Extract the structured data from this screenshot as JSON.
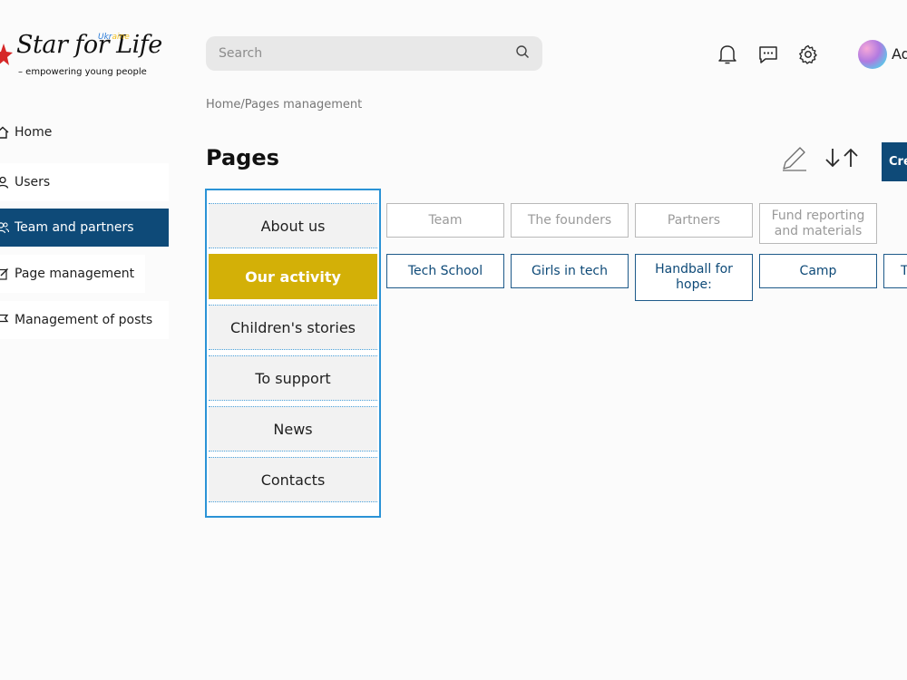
{
  "logo": {
    "name": "Star for Life",
    "ukraine_part1": "Ukr",
    "ukraine_part2": "aine",
    "tagline": "– empowering young people"
  },
  "sidebar": {
    "items": [
      {
        "label": "Home",
        "icon": "home-icon"
      },
      {
        "label": "Users",
        "icon": "user-icon"
      },
      {
        "label": "Team and partners",
        "icon": "users-icon"
      },
      {
        "label": "Page management",
        "icon": "edit-icon"
      },
      {
        "label": "Management of posts",
        "icon": "flag-icon"
      }
    ],
    "active_index": 2
  },
  "search": {
    "placeholder": "Search"
  },
  "header": {
    "icons": [
      "bell-icon",
      "chat-icon",
      "gear-icon"
    ],
    "user_name": "Ad"
  },
  "breadcrumb": "Home/Pages management",
  "page_title": "Pages",
  "toolbar": {
    "create_label": "Cre"
  },
  "pages": [
    {
      "label": "About us"
    },
    {
      "label": "Our activity"
    },
    {
      "label": "Children's stories"
    },
    {
      "label": "To support"
    },
    {
      "label": "News"
    },
    {
      "label": "Contacts"
    }
  ],
  "active_page_index": 1,
  "about_subpages": [
    "Team",
    "The founders",
    "Partners",
    "Fund reporting and materials"
  ],
  "activity_subpages": [
    "Tech School",
    "Girls in tech",
    "Handball for hope:",
    "Camp",
    "T"
  ],
  "colors": {
    "primary": "#0e4a78",
    "accent_yellow": "#d3b007",
    "list_border": "#2b93d6"
  }
}
